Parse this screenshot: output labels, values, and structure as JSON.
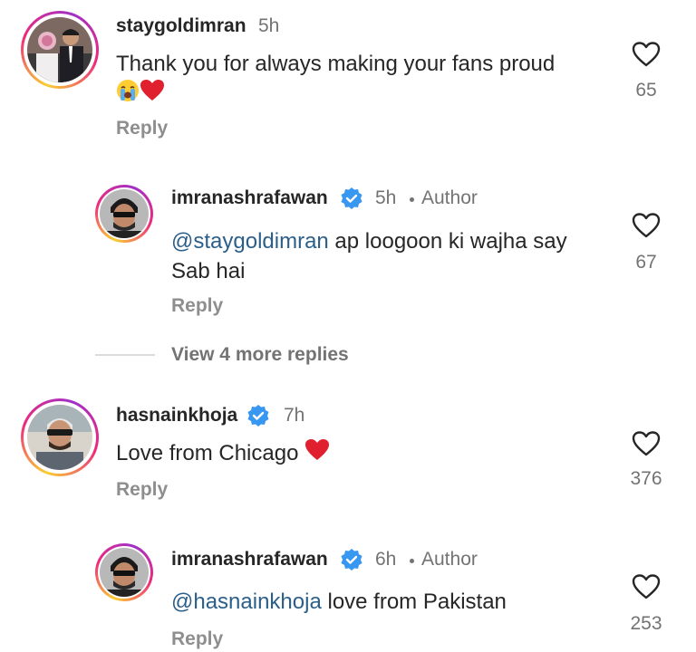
{
  "comments": [
    {
      "username": "staygoldimran",
      "time": "5h",
      "text": "Thank you for always making your fans proud",
      "emoji": [
        "loudly-crying-face-emoji",
        "red-heart-emoji"
      ],
      "reply_label": "Reply",
      "likes": "65"
    },
    {
      "username": "imranashrafawan",
      "verified": true,
      "time": "5h",
      "author_label": "Author",
      "mention": "@staygoldimran",
      "text": " ap loogoon ki wajha say Sab hai",
      "reply_label": "Reply",
      "likes": "67"
    },
    {
      "username": "hasnainkhoja",
      "verified": true,
      "time": "7h",
      "text": "Love from Chicago",
      "emoji": [
        "red-heart-emoji"
      ],
      "reply_label": "Reply",
      "likes": "376"
    },
    {
      "username": "imranashrafawan",
      "verified": true,
      "time": "6h",
      "author_label": "Author",
      "mention": "@hasnainkhoja",
      "text": " love from Pakistan",
      "reply_label": "Reply",
      "likes": "253"
    }
  ],
  "view_more": {
    "label": "View 4 more replies"
  },
  "colors": {
    "username": "#262626",
    "meta": "#737373",
    "mention": "#2b5f8a",
    "verified": "#3897f0",
    "heart_emoji": "#e0202e"
  },
  "icons": {
    "like": "heart-outline-icon",
    "verified": "verified-badge-icon"
  }
}
